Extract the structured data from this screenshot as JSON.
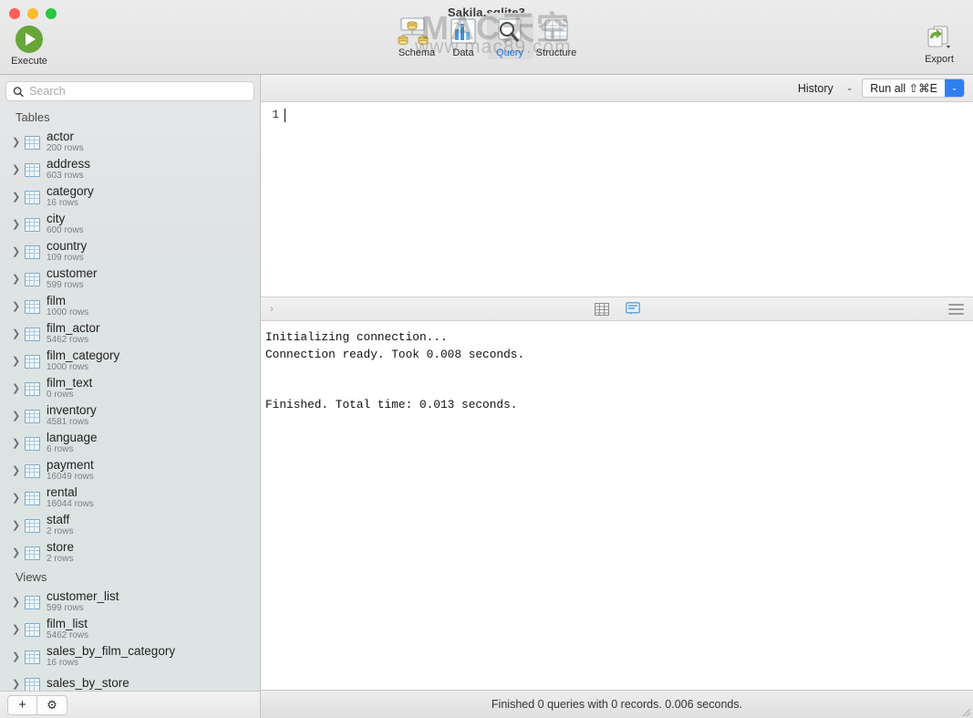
{
  "window": {
    "title": "Sakila.sqlite3",
    "watermark_big": "MAC天空",
    "watermark_small": "www.mac89.com"
  },
  "toolbar": {
    "execute_label": "Execute",
    "export_label": "Export",
    "tabs": [
      {
        "label": "Schema",
        "icon": "schema-icon",
        "active": false
      },
      {
        "label": "Data",
        "icon": "data-icon",
        "active": false
      },
      {
        "label": "Query",
        "icon": "query-icon",
        "active": true
      },
      {
        "label": "Structure",
        "icon": "structure-icon",
        "active": false
      }
    ]
  },
  "query_bar": {
    "history_label": "History",
    "history_chevron": "⌄",
    "run_all_label": "Run all ⇧⌘E",
    "run_all_caret": "⌄"
  },
  "sidebar": {
    "search_placeholder": "Search",
    "search_value": "",
    "search_icon": "search-icon",
    "groups": [
      {
        "title": "Tables",
        "items": [
          {
            "name": "actor",
            "rows": "200 rows"
          },
          {
            "name": "address",
            "rows": "603 rows"
          },
          {
            "name": "category",
            "rows": "16 rows"
          },
          {
            "name": "city",
            "rows": "600 rows"
          },
          {
            "name": "country",
            "rows": "109 rows"
          },
          {
            "name": "customer",
            "rows": "599 rows"
          },
          {
            "name": "film",
            "rows": "1000 rows"
          },
          {
            "name": "film_actor",
            "rows": "5462 rows"
          },
          {
            "name": "film_category",
            "rows": "1000 rows"
          },
          {
            "name": "film_text",
            "rows": "0 rows"
          },
          {
            "name": "inventory",
            "rows": "4581 rows"
          },
          {
            "name": "language",
            "rows": "6 rows"
          },
          {
            "name": "payment",
            "rows": "16049 rows"
          },
          {
            "name": "rental",
            "rows": "16044 rows"
          },
          {
            "name": "staff",
            "rows": "2 rows"
          },
          {
            "name": "store",
            "rows": "2 rows"
          }
        ]
      },
      {
        "title": "Views",
        "items": [
          {
            "name": "customer_list",
            "rows": "599 rows"
          },
          {
            "name": "film_list",
            "rows": "5462 rows"
          },
          {
            "name": "sales_by_film_category",
            "rows": "16 rows"
          },
          {
            "name": "sales_by_store",
            "rows": ""
          }
        ]
      }
    ],
    "footer": {
      "add_label": "+",
      "gear_label": "⚙"
    }
  },
  "editor": {
    "line_number": "1",
    "content": ""
  },
  "console_bar": {
    "left_chevron": "›",
    "grid_icon": "table-view-icon",
    "console_icon": "console-view-icon",
    "menu_icon": "hamburger-menu-icon"
  },
  "console": {
    "text": "Initializing connection...\nConnection ready. Took 0.008 seconds.\n\n\nFinished. Total time: 0.013 seconds."
  },
  "status_bar": {
    "text": "Finished 0 queries with 0 records. 0.006 seconds."
  },
  "colors": {
    "accent_blue": "#1a73e8",
    "run_button_blue": "#2f7ff0",
    "execute_green": "#68a63a",
    "traffic_red": "#ff5f57",
    "traffic_yellow": "#febc2e",
    "traffic_green": "#28c840"
  }
}
